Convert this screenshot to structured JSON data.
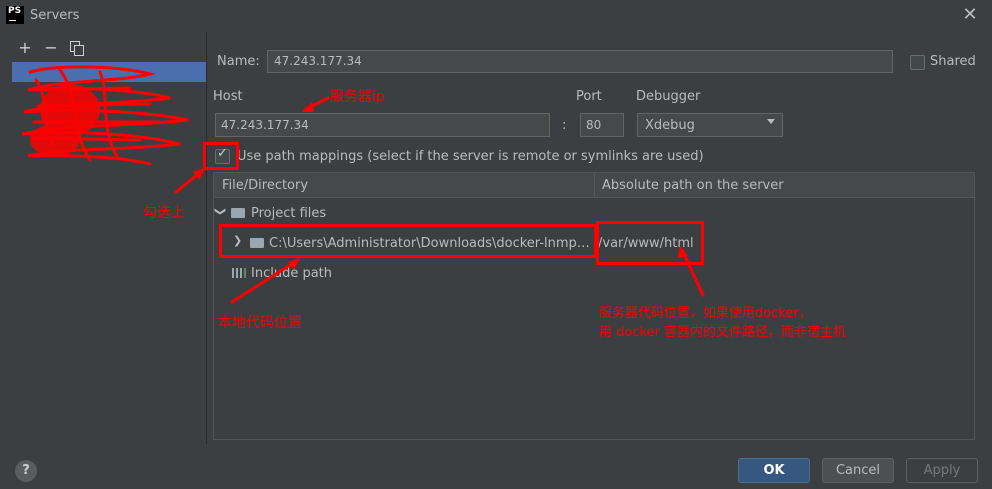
{
  "window": {
    "title": "Servers",
    "logo_text": "PS"
  },
  "toolbar": {
    "add_symbol": "+",
    "remove_symbol": "−"
  },
  "form": {
    "name_label": "Name:",
    "name_value": "47.243.177.34",
    "shared_label": "Shared",
    "shared_checked": false,
    "host_label": "Host",
    "host_value": "47.243.177.34",
    "colon": ":",
    "port_label": "Port",
    "port_value": "80",
    "debugger_label": "Debugger",
    "debugger_value": "Xdebug",
    "path_mapping_label": "Use path mappings (select if the server is remote or symlinks are used)",
    "path_mapping_checked": true
  },
  "table": {
    "columns": [
      "File/Directory",
      "Absolute path on the server"
    ],
    "project_files_label": "Project files",
    "local_path": "C:\\Users\\Administrator\\Downloads\\docker-lnmp-mast...",
    "server_path": "/var/www/html",
    "include_path_label": "Include path"
  },
  "annotations": {
    "server_ip": "服务器ip",
    "check_on": "勾选上",
    "local_code": "本地代码位置",
    "server_code_line1": "服务器代码位置，如果使用docker，",
    "server_code_line2": "用 docker 容器内的文件路径，而非宿主机",
    "color": "#ff0000"
  },
  "footer": {
    "help_label": "?",
    "ok_label": "OK",
    "cancel_label": "Cancel",
    "apply_label": "Apply"
  },
  "colors": {
    "background": "#3c3f41",
    "selection": "#4b6eaf",
    "primary_button": "#365880"
  }
}
